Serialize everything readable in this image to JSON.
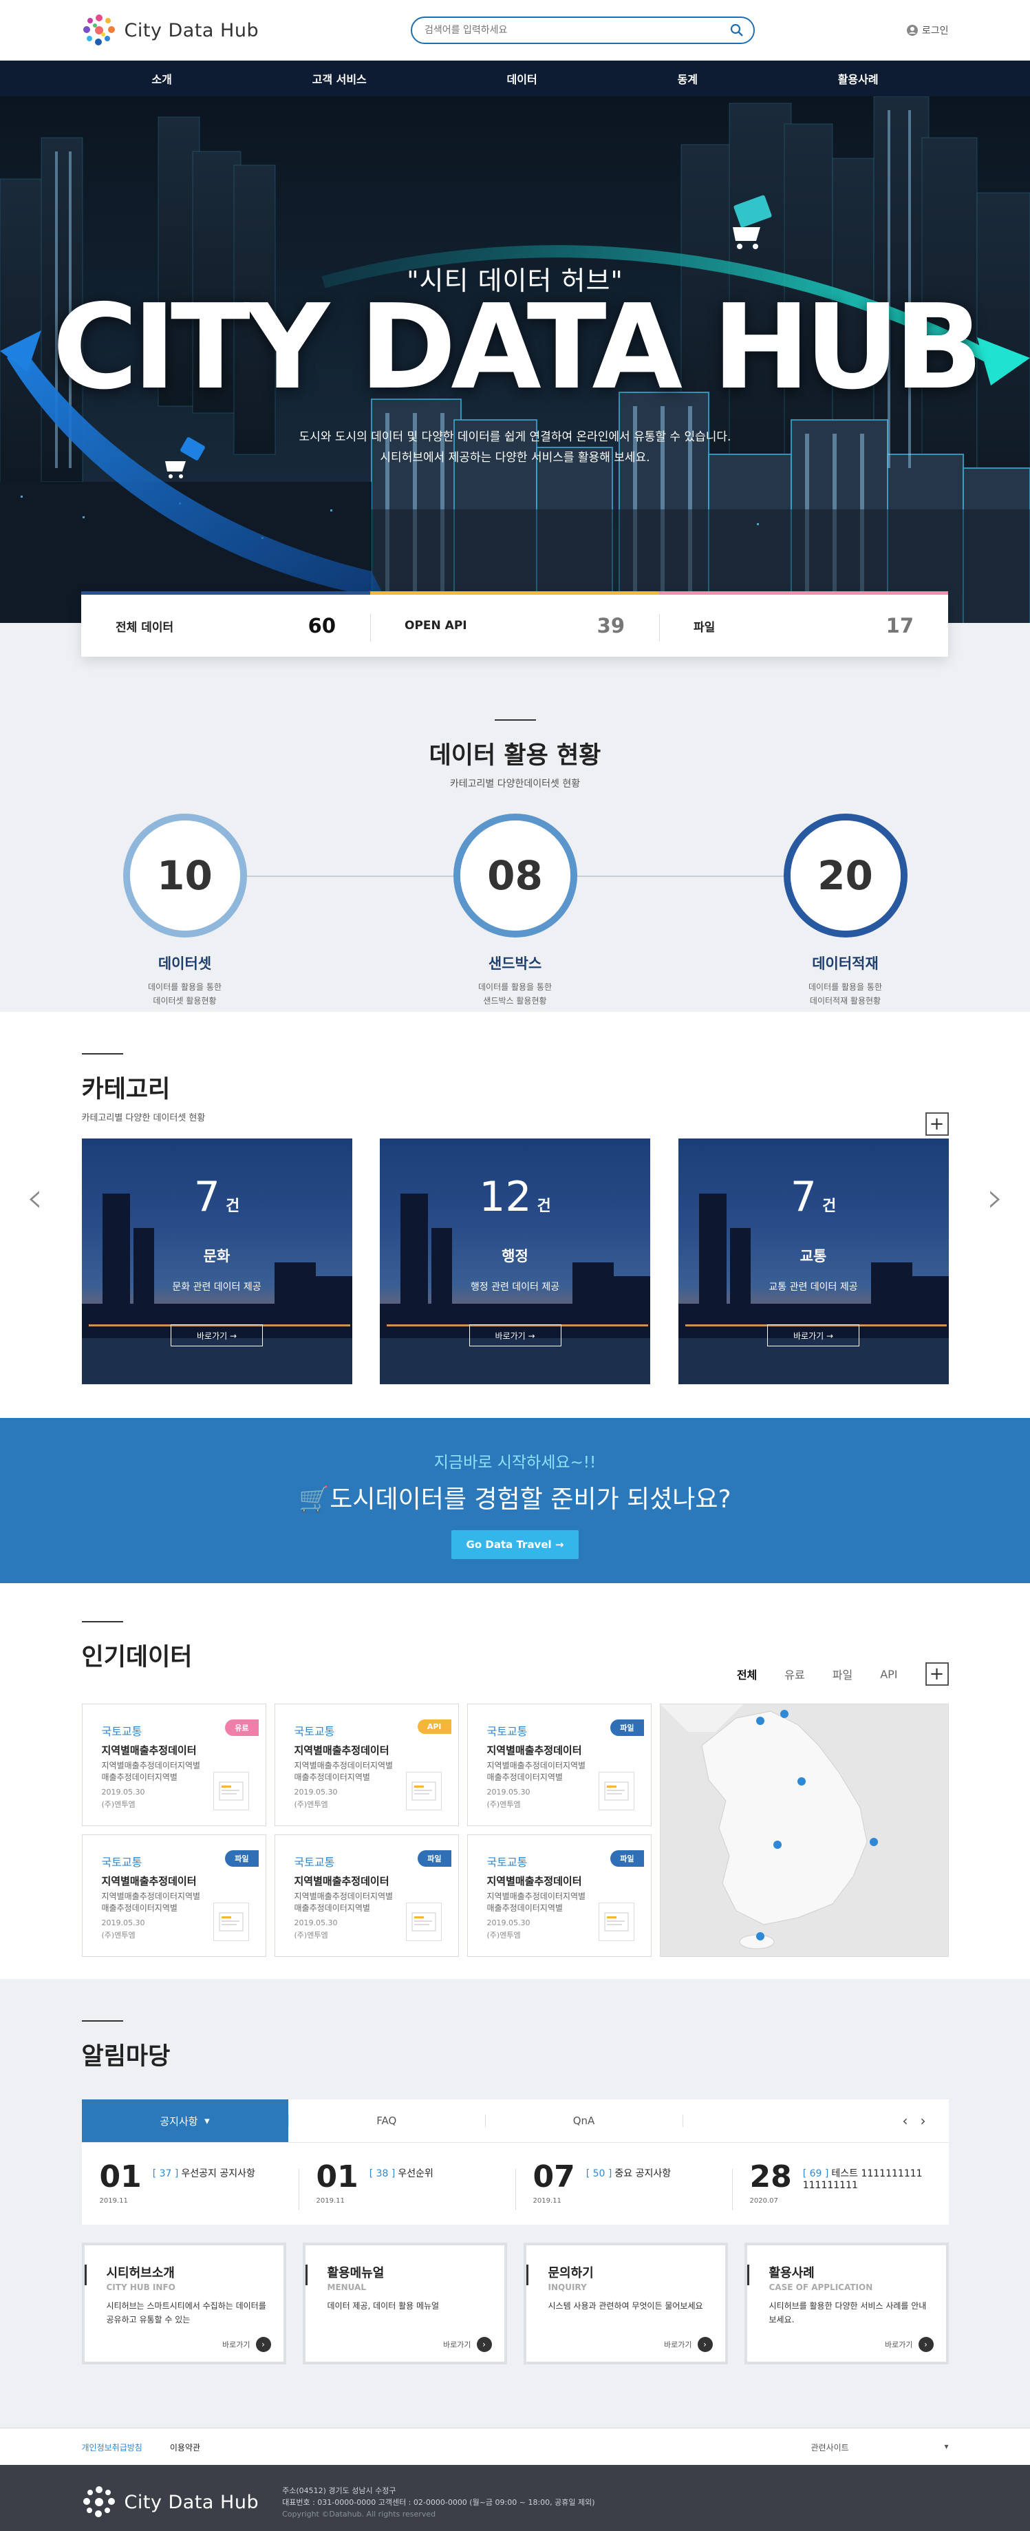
{
  "header": {
    "logo_text": "City Data Hub",
    "search_placeholder": "검색어를 입력하세요",
    "login_label": "로그인"
  },
  "nav": [
    "소개",
    "고객 서비스",
    "데이터",
    "동계",
    "활용사례"
  ],
  "hero": {
    "subtitle": "\"시티 데이터 허브\"",
    "title": "CITY DATA HUB",
    "desc_line1": "도시와 도시의 데이터 및 다양한 데이터를 쉽게 연결하여 온라인에서 유통할 수 있습니다.",
    "desc_line2": "시티허브에서 제공하는 다양한 서비스를 활용해 보세요."
  },
  "stats": [
    {
      "label": "전체 데이터",
      "value": "60",
      "color": "#2b5390",
      "value_color": "#111"
    },
    {
      "label": "OPEN API",
      "value": "39",
      "color": "#f5b53a",
      "value_color": "#777"
    },
    {
      "label": "파일",
      "value": "17",
      "color": "#ef8fad",
      "value_color": "#777"
    }
  ],
  "usage": {
    "title": "데이터 활용 현황",
    "subtitle": "카테고리별 다양한데이터셋 현황",
    "items": [
      {
        "value": "10",
        "name": "데이터셋",
        "desc1": "데이터를 활용을 통한",
        "desc2": "데이터셋 활용현황",
        "ring": "#8fb7dc"
      },
      {
        "value": "08",
        "name": "샌드박스",
        "desc1": "데이터를 활용을 통한",
        "desc2": "샌드박스 활용현황",
        "ring": "#5a95cc"
      },
      {
        "value": "20",
        "name": "데이터적재",
        "desc1": "데이터를 활용을 통한",
        "desc2": "데이터적재 활용현황",
        "ring": "#2858a0"
      }
    ]
  },
  "category": {
    "title": "카테고리",
    "subtitle": "카테고리별 다양한 데이터셋 현황",
    "unit": "건",
    "button": "바로가기 →",
    "cards": [
      {
        "count": "7",
        "name": "문화",
        "desc": "문화 관련 데이터 제공"
      },
      {
        "count": "12",
        "name": "행정",
        "desc": "행정 관련 데이터 제공"
      },
      {
        "count": "7",
        "name": "교통",
        "desc": "교통 관련 데이터 제공"
      }
    ]
  },
  "cta": {
    "line1": "지금바로 시작하세요~!!",
    "line2": "도시데이터를 경험할 준비가 되셨나요?",
    "button": "Go Data Travel →"
  },
  "popular": {
    "title": "인기데이터",
    "tabs": [
      "전체",
      "유료",
      "파일",
      "API"
    ],
    "cards": [
      {
        "org": "국토교통",
        "title": "지역별매출추정데이터",
        "s1": "지역별매출추정데이터지역별",
        "s2": "매출추정데이터지역별",
        "date": "2019.05.30",
        "by": "(주)엔투엠",
        "badge": "유료",
        "badge_color": "#ef7ea8"
      },
      {
        "org": "국토교통",
        "title": "지역별매출추정데이터",
        "s1": "지역별매출추정데이터지역별",
        "s2": "매출추정데이터지역별",
        "date": "2019.05.30",
        "by": "(주)엔투엠",
        "badge": "API",
        "badge_color": "#f5b53a"
      },
      {
        "org": "국토교통",
        "title": "지역별매출추정데이터",
        "s1": "지역별매출추정데이터지역별",
        "s2": "매출추정데이터지역별",
        "date": "2019.05.30",
        "by": "(주)엔투엠",
        "badge": "파일",
        "badge_color": "#2e6fb5"
      },
      {
        "org": "국토교통",
        "title": "지역별매출추정데이터",
        "s1": "지역별매출추정데이터지역별",
        "s2": "매출추정데이터지역별",
        "date": "2019.05.30",
        "by": "(주)엔투엠",
        "badge": "파일",
        "badge_color": "#2e6fb5"
      },
      {
        "org": "국토교통",
        "title": "지역별매출추정데이터",
        "s1": "지역별매출추정데이터지역별",
        "s2": "매출추정데이터지역별",
        "date": "2019.05.30",
        "by": "(주)엔투엠",
        "badge": "파일",
        "badge_color": "#2e6fb5"
      },
      {
        "org": "국토교통",
        "title": "지역별매출추정데이터",
        "s1": "지역별매출추정데이터지역별",
        "s2": "매출추정데이터지역별",
        "date": "2019.05.30",
        "by": "(주)엔투엠",
        "badge": "파일",
        "badge_color": "#2e6fb5"
      }
    ]
  },
  "notice": {
    "title": "알림마당",
    "tabs": [
      "공지사항",
      "FAQ",
      "QnA"
    ],
    "items": [
      {
        "day": "01",
        "num": "[ 37 ]",
        "text": "우선공지 공지사항",
        "ym": "2019.11"
      },
      {
        "day": "01",
        "num": "[ 38 ]",
        "text": "우선순위",
        "ym": "2019.11"
      },
      {
        "day": "07",
        "num": "[ 50 ]",
        "text": "중요 공지사항",
        "ym": "2019.11"
      },
      {
        "day": "28",
        "num": "[ 69 ]",
        "text": "테스트 1111111111111111111",
        "ym": "2020.07"
      }
    ],
    "boxes": [
      {
        "title": "시티허브소개",
        "en": "CITY HUB INFO",
        "desc": "시티허브는 스마트시티에서 수집하는 데이터를 공유하고 유통할 수 있는",
        "more": "바로가기"
      },
      {
        "title": "활용메뉴얼",
        "en": "MENUAL",
        "desc": "데이터 제공, 데이터 활용 메뉴얼",
        "more": "바로가기"
      },
      {
        "title": "문의하기",
        "en": "INQUIRY",
        "desc": "시스템 사용과 관련하여 무엇이든 물어보세요",
        "more": "바로가기"
      },
      {
        "title": "활용사례",
        "en": "CASE OF APPLICATION",
        "desc": "시티허브를 활용한 다양한 서비스 사례를 안내보세요.",
        "more": "바로가기"
      }
    ]
  },
  "footer": {
    "policy": "개인정보취급방침",
    "terms": "이용약관",
    "related": "관련사이트",
    "logo_text": "City Data Hub",
    "addr": "주소(04512) 경기도 성남시 수정구",
    "tel": "대표번호 : 031-0000-0000   고객센터 : 02-0000-0000 (월~금 09:00 ~ 18:00, 공휴일 제외)",
    "copy": "Copyright ©Datahub. All rights reserved"
  }
}
